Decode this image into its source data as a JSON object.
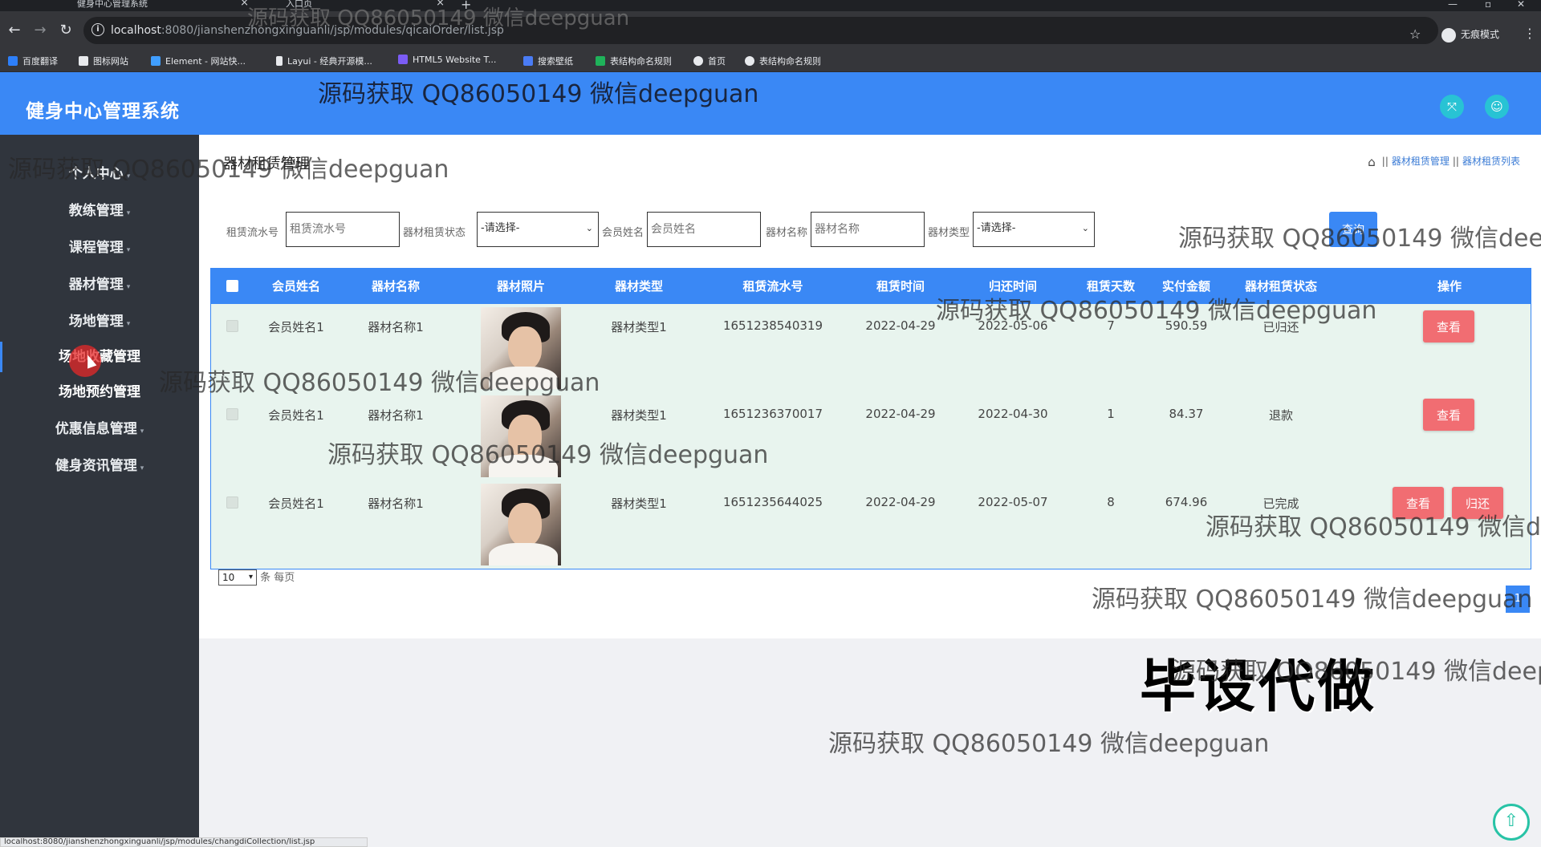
{
  "browser": {
    "tabs": [
      {
        "title": "健身中心管理系统"
      },
      {
        "title": "入口页"
      }
    ],
    "url_host": "localhost",
    "url_path": ":8080/jianshenzhongxinguanli/jsp/modules/qicaiOrder/list.jsp",
    "incognito_label": "无痕模式",
    "bookmarks": [
      "百度翻译",
      "图标网站",
      "Element - 网站快...",
      "Layui - 经典开源模...",
      "HTML5 Website T...",
      "搜索壁纸",
      "表结构命名规则",
      "首页",
      "表结构命名规则"
    ],
    "status_url": "localhost:8080/jianshenzhongxinguanli/jsp/modules/changdiCollection/list.jsp"
  },
  "header": {
    "title": "健身中心管理系统"
  },
  "sidebar": {
    "items": [
      {
        "label": "个人中心"
      },
      {
        "label": "教练管理"
      },
      {
        "label": "课程管理"
      },
      {
        "label": "器材管理"
      },
      {
        "label": "场地管理"
      },
      {
        "label": "场地收藏管理"
      },
      {
        "label": "场地预约管理"
      },
      {
        "label": "优惠信息管理"
      },
      {
        "label": "健身资讯管理"
      }
    ]
  },
  "page": {
    "title": "器材租赁管理",
    "breadcrumb": [
      "器材租赁管理",
      "器材租赁列表"
    ]
  },
  "search": {
    "order_no_label": "租赁流水号",
    "order_no_placeholder": "租赁流水号",
    "status_label": "器材租赁状态",
    "status_value": "-请选择-",
    "member_label": "会员姓名",
    "member_placeholder": "会员姓名",
    "equipment_label": "器材名称",
    "equipment_placeholder": "器材名称",
    "type_label": "器材类型",
    "type_value": "-请选择-",
    "query_button": "查询"
  },
  "table": {
    "headers": [
      "会员姓名",
      "器材名称",
      "器材照片",
      "器材类型",
      "租赁流水号",
      "租赁时间",
      "归还时间",
      "租赁天数",
      "实付金额",
      "器材租赁状态",
      "操作"
    ],
    "rows": [
      {
        "member": "会员姓名1",
        "name": "器材名称1",
        "type": "器材类型1",
        "order_no": "1651238540319",
        "rent_date": "2022-04-29",
        "return_date": "2022-05-06",
        "days": "7",
        "amount": "590.59",
        "status": "已归还",
        "actions": [
          "查看"
        ]
      },
      {
        "member": "会员姓名1",
        "name": "器材名称1",
        "type": "器材类型1",
        "order_no": "1651236370017",
        "rent_date": "2022-04-29",
        "return_date": "2022-04-30",
        "days": "1",
        "amount": "84.37",
        "status": "退款",
        "actions": [
          "查看"
        ]
      },
      {
        "member": "会员姓名1",
        "name": "器材名称1",
        "type": "器材类型1",
        "order_no": "1651235644025",
        "rent_date": "2022-04-29",
        "return_date": "2022-05-07",
        "days": "8",
        "amount": "674.96",
        "status": "已完成",
        "actions": [
          "查看",
          "归还"
        ]
      }
    ]
  },
  "pagination": {
    "page_size": "10",
    "per_page_label": "条 每页",
    "current_page": "1"
  },
  "overlay": {
    "stamp": "毕设代做",
    "watermark": "源码获取 QQ86050149 微信deepguan"
  },
  "colors": {
    "primary": "#3a88f5",
    "sidebar": "#30353d",
    "danger": "#f16d72",
    "teal": "#28c3d4"
  }
}
